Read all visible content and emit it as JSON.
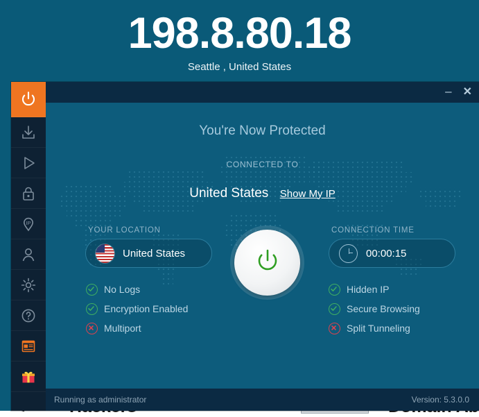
{
  "backdrop": {
    "text_fragment_1": "e",
    "text_fragment_2": "Hackers",
    "text_fragment_3": "Domain Abu"
  },
  "header": {
    "ip_address": "198.8.80.18",
    "location": "Seattle , United States"
  },
  "window": {
    "minimize_label": "–",
    "close_label": "✕"
  },
  "main": {
    "status_title": "You're Now Protected",
    "connected_to_label": "CONNECTED TO",
    "country": "United States",
    "show_my_ip_link": "Show My IP",
    "your_location_label": "YOUR LOCATION",
    "your_location_value": "United States",
    "connection_time_label": "CONNECTION TIME",
    "connection_time_value": "00:00:15",
    "power_state": "on"
  },
  "features_left": [
    {
      "label": "No Logs",
      "enabled": true
    },
    {
      "label": "Encryption Enabled",
      "enabled": true
    },
    {
      "label": "Multiport",
      "enabled": false
    }
  ],
  "features_right": [
    {
      "label": "Hidden IP",
      "enabled": true
    },
    {
      "label": "Secure Browsing",
      "enabled": true
    },
    {
      "label": "Split Tunneling",
      "enabled": false
    }
  ],
  "sidebar": [
    {
      "icon": "power-icon",
      "name": "sidebar-item-power",
      "active": true
    },
    {
      "icon": "download-icon",
      "name": "sidebar-item-download",
      "active": false
    },
    {
      "icon": "play-icon",
      "name": "sidebar-item-streaming",
      "active": false
    },
    {
      "icon": "lock-icon",
      "name": "sidebar-item-security",
      "active": false
    },
    {
      "icon": "ip-pin-icon",
      "name": "sidebar-item-ip",
      "active": false
    },
    {
      "icon": "user-icon",
      "name": "sidebar-item-account",
      "active": false
    },
    {
      "icon": "gear-icon",
      "name": "sidebar-item-settings",
      "active": false
    },
    {
      "icon": "help-icon",
      "name": "sidebar-item-help",
      "active": false
    },
    {
      "icon": "news-icon",
      "name": "sidebar-item-news",
      "active": false
    },
    {
      "icon": "gift-icon",
      "name": "sidebar-item-offers",
      "active": false
    }
  ],
  "statusbar": {
    "left": "Running as administrator",
    "right": "Version:  5.3.0.0"
  },
  "colors": {
    "teal": "#0a5a78",
    "panel": "#0d5c7c",
    "navy": "#0e2133",
    "titlebar": "#0b2a43",
    "accent_orange": "#ef7521",
    "ok_green": "#3fae62",
    "bad_red": "#d9434f"
  }
}
